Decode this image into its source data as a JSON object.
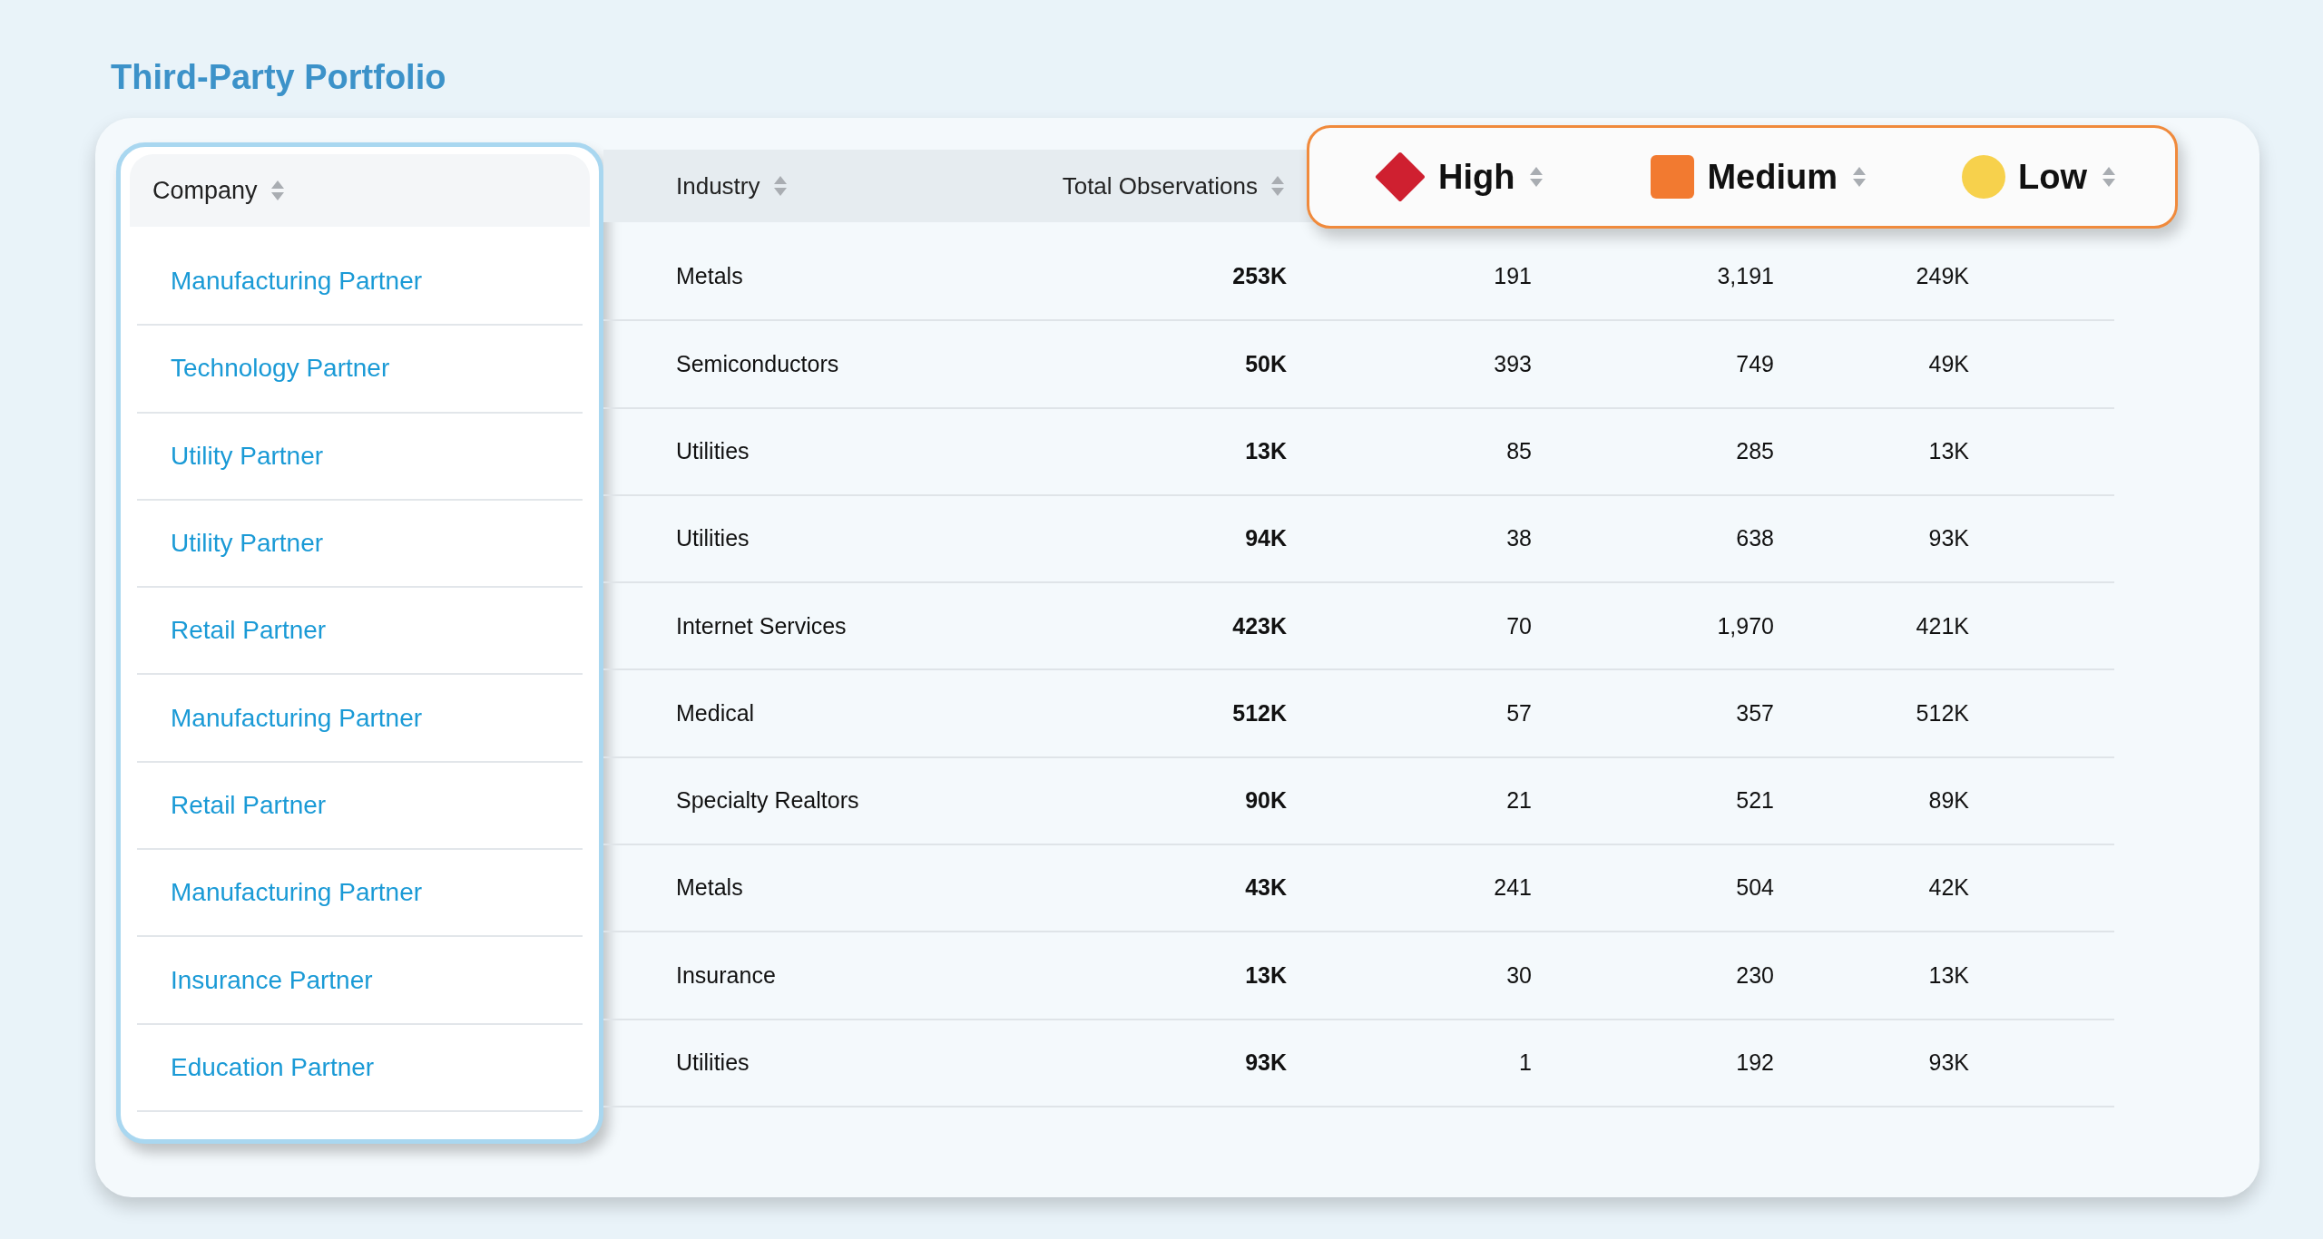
{
  "title": "Third-Party Portfolio",
  "columns": [
    {
      "label": "Company"
    },
    {
      "label": "Industry"
    },
    {
      "label": "Total Observations"
    }
  ],
  "severity_columns": [
    {
      "kind": "diamond",
      "label": "High",
      "color": "#cf2030"
    },
    {
      "kind": "square",
      "label": "Medium",
      "color": "#f27a30"
    },
    {
      "kind": "circle",
      "label": "Low",
      "color": "#f7d14c"
    }
  ],
  "rows": [
    {
      "company": "Manufacturing Partner",
      "industry": "Metals",
      "total": "253K",
      "high": "191",
      "medium": "3,191",
      "low": "249K"
    },
    {
      "company": "Technology Partner",
      "industry": "Semiconductors",
      "total": "50K",
      "high": "393",
      "medium": "749",
      "low": "49K"
    },
    {
      "company": "Utility Partner",
      "industry": "Utilities",
      "total": "13K",
      "high": "85",
      "medium": "285",
      "low": "13K"
    },
    {
      "company": "Utility Partner",
      "industry": "Utilities",
      "total": "94K",
      "high": "38",
      "medium": "638",
      "low": "93K"
    },
    {
      "company": "Retail Partner",
      "industry": "Internet Services",
      "total": "423K",
      "high": "70",
      "medium": "1,970",
      "low": "421K"
    },
    {
      "company": "Manufacturing Partner",
      "industry": "Medical",
      "total": "512K",
      "high": "57",
      "medium": "357",
      "low": "512K"
    },
    {
      "company": "Retail Partner",
      "industry": "Specialty Realtors",
      "total": "90K",
      "high": "21",
      "medium": "521",
      "low": "89K"
    },
    {
      "company": "Manufacturing Partner",
      "industry": "Metals",
      "total": "43K",
      "high": "241",
      "medium": "504",
      "low": "42K"
    },
    {
      "company": "Insurance Partner",
      "industry": "Insurance",
      "total": "13K",
      "high": "30",
      "medium": "230",
      "low": "13K"
    },
    {
      "company": "Education Partner",
      "industry": "Utilities",
      "total": "93K",
      "high": "1",
      "medium": "192",
      "low": "93K"
    }
  ]
}
